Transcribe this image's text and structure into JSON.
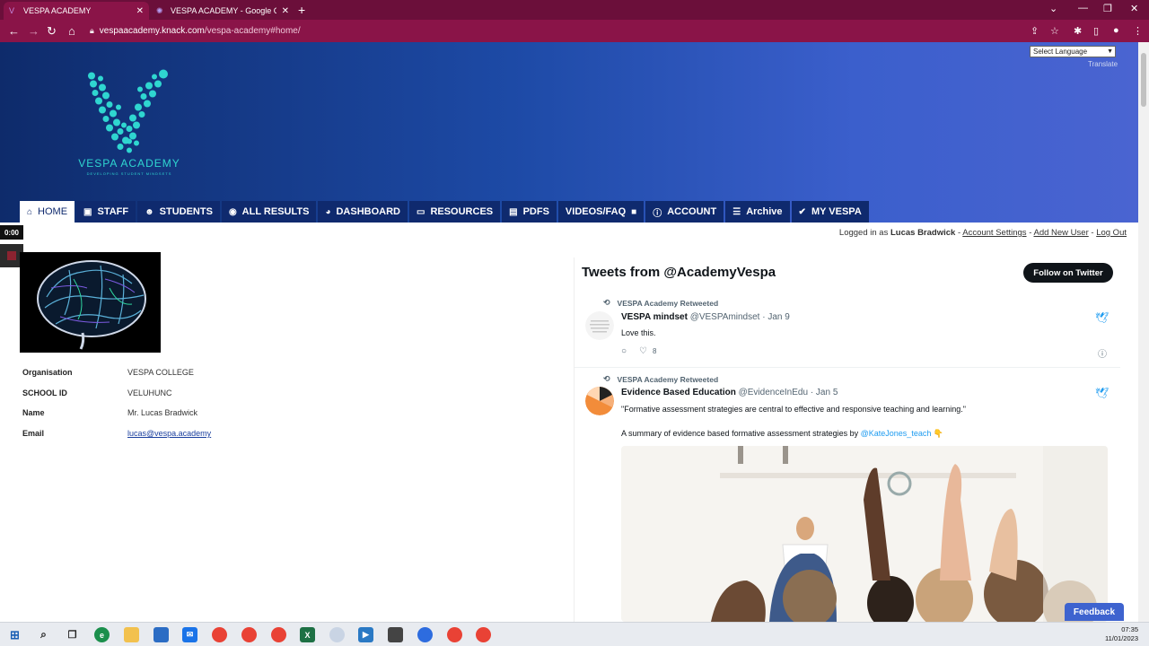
{
  "browser": {
    "tabs": [
      {
        "title": "VESPA ACADEMY",
        "active": true
      },
      {
        "title": "VESPA ACADEMY - Google Chro",
        "active": false
      }
    ],
    "url_host": "vespaacademy.knack.com",
    "url_path": "/vespa-academy#home/"
  },
  "header": {
    "logo_text": "VESPA ACADEMY",
    "logo_subtext": "DEVELOPING STUDENT MINDSETS",
    "language_select": "Select Language",
    "translate_label": "Translate"
  },
  "nav": {
    "items": [
      {
        "label": "HOME",
        "icon": "home-icon",
        "glyph": "⌂"
      },
      {
        "label": "STAFF",
        "icon": "id-card-icon",
        "glyph": "▣"
      },
      {
        "label": "STUDENTS",
        "icon": "users-icon",
        "glyph": "☻"
      },
      {
        "label": "ALL RESULTS",
        "icon": "target-icon",
        "glyph": "◉"
      },
      {
        "label": "DASHBOARD",
        "icon": "pie-chart-icon",
        "glyph": "◕"
      },
      {
        "label": "RESOURCES",
        "icon": "monitor-icon",
        "glyph": "▭"
      },
      {
        "label": "PDFS",
        "icon": "file-icon",
        "glyph": "▤"
      },
      {
        "label": "VIDEOS/FAQ",
        "icon": "video-icon",
        "glyph": "■"
      },
      {
        "label": "ACCOUNT",
        "icon": "info-icon",
        "glyph": "ⓘ"
      },
      {
        "label": "Archive",
        "icon": "archive-icon",
        "glyph": "☰"
      },
      {
        "label": "MY VESPA",
        "icon": "check-circle-icon",
        "glyph": "✔"
      }
    ]
  },
  "session": {
    "prefix": "Logged in as",
    "user": "Lucas Bradwick",
    "account_settings": "Account Settings",
    "add_new_user": "Add New User",
    "log_out": "Log Out",
    "sep": "-"
  },
  "recorder": {
    "timer": "0:00"
  },
  "profile": {
    "rows": [
      {
        "label": "Organisation",
        "value": "VESPA COLLEGE"
      },
      {
        "label": "SCHOOL ID",
        "value": "VELUHUNC"
      },
      {
        "label": "Name",
        "value": "Mr. Lucas Bradwick"
      },
      {
        "label": "Email",
        "value": "lucas@vespa.academy"
      }
    ]
  },
  "twitter": {
    "title": "Tweets from @AcademyVespa",
    "follow": "Follow on Twitter",
    "tweets": [
      {
        "retweet_label": "VESPA Academy Retweeted",
        "name": "VESPA mindset",
        "handle": "@VESPAmindset",
        "date": "· Jan 9",
        "text": "Love this.",
        "likes": "8"
      },
      {
        "retweet_label": "VESPA Academy Retweeted",
        "name": "Evidence Based Education",
        "handle": "@EvidenceInEdu",
        "date": "· Jan 5",
        "text": "\"Formative assessment strategies are central to effective and responsive teaching and learning.\"",
        "text2": "A summary of evidence based formative assessment strategies by",
        "mention": "@KateJones_teach",
        "emoji": "👇"
      }
    ]
  },
  "feedback": "Feedback",
  "taskbar": {
    "time": "07:35",
    "date": "11/01/2023"
  },
  "colors": {
    "tab_bg": "#6b0f3a",
    "addr_bg": "#8a1448",
    "nav_bg": "#0f2a6e",
    "accent_teal": "#2fd6d0",
    "twitter_blue": "#1d9bf0"
  }
}
